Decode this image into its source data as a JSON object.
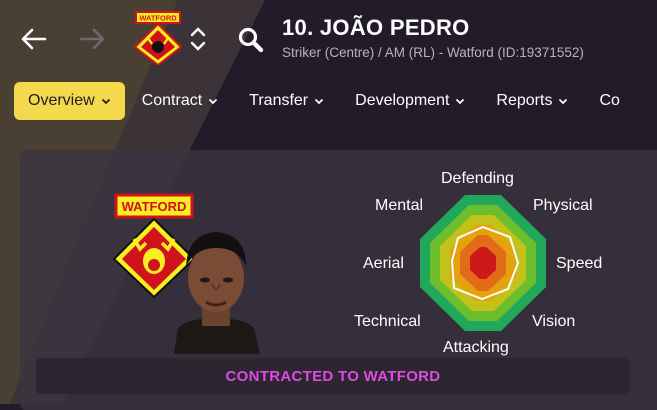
{
  "header": {
    "player_title": "10. JOÃO PEDRO",
    "player_subtitle": "Striker (Centre) / AM (RL) - Watford (ID:19371552)",
    "crest_text": "WATFORD"
  },
  "tabs": [
    {
      "label": "Overview",
      "active": true
    },
    {
      "label": "Contract",
      "active": false
    },
    {
      "label": "Transfer",
      "active": false
    },
    {
      "label": "Development",
      "active": false
    },
    {
      "label": "Reports",
      "active": false
    },
    {
      "label": "Co",
      "active": false
    }
  ],
  "radar": {
    "labels": {
      "defending": "Defending",
      "physical": "Physical",
      "speed": "Speed",
      "vision": "Vision",
      "attacking": "Attacking",
      "technical": "Technical",
      "aerial": "Aerial",
      "mental": "Mental"
    }
  },
  "club_crest_text": "WATFORD",
  "status": "CONTRACTED TO WATFORD",
  "colors": {
    "accent": "#f5d94c",
    "status_text": "#e04ae0",
    "background": "#221b2a"
  }
}
